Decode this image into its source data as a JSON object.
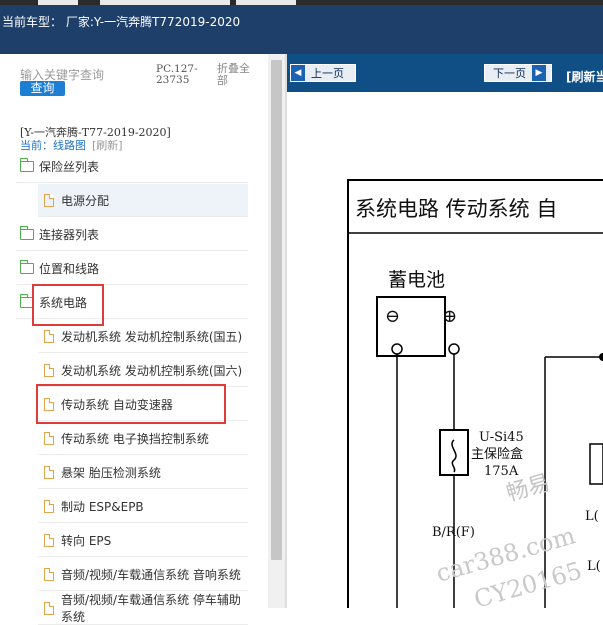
{
  "header": {
    "vehicle_text": "当前车型： 厂家:Y-一汽奔腾T772019-2020"
  },
  "search": {
    "placeholder": "输入关键字查询",
    "button": "查询"
  },
  "info": {
    "pc_code": "PC.127-23735",
    "collapse_all": "折叠全部"
  },
  "breadcrumb": {
    "path": "[Y-一汽奔腾-T77-2019-2020]",
    "current": "当前：线路图",
    "refresh": "[刷新]"
  },
  "tree": [
    {
      "label": "保险丝列表",
      "type": "folder"
    },
    {
      "label": "电源分配",
      "type": "doc"
    },
    {
      "label": "连接器列表",
      "type": "folder"
    },
    {
      "label": "位置和线路",
      "type": "folder"
    },
    {
      "label": "系统电路",
      "type": "folder"
    },
    {
      "label": "发动机系统 发动机控制系统(国五)",
      "type": "doc"
    },
    {
      "label": "发动机系统 发动机控制系统(国六)",
      "type": "doc"
    },
    {
      "label": "传动系统 自动变速器",
      "type": "doc"
    },
    {
      "label": "传动系统 电子换挡控制系统",
      "type": "doc"
    },
    {
      "label": "悬架 胎压检测系统",
      "type": "doc"
    },
    {
      "label": "制动 ESP&EPB",
      "type": "doc"
    },
    {
      "label": "转向 EPS",
      "type": "doc"
    },
    {
      "label": "音频/视频/车载通信系统 音响系统",
      "type": "doc"
    },
    {
      "label": "音频/视频/车载通信系统 停车辅助系统",
      "type": "doc"
    }
  ],
  "viewer": {
    "prev": "上一页",
    "next": "下一页",
    "refresh": "[刷新当"
  },
  "diagram": {
    "title": "系统电路 传动系统 自",
    "battery": "蓄电池",
    "minus": "⊖",
    "plus": "⊕",
    "fuse_id": "U-Si45",
    "fuse_box": "主保险盒",
    "fuse_rating": "175A",
    "wire": "B/R(F)",
    "partial_1": "L(",
    "partial_2": "L(",
    "watermark_1": "畅易",
    "watermark_2": "car388.com",
    "watermark_3": "CY20165"
  },
  "colors": {
    "header_bg": "#1f3f6b",
    "nav_bg": "#0f4f86",
    "highlight": "#e03b3b",
    "button": "#1e7fd2"
  }
}
